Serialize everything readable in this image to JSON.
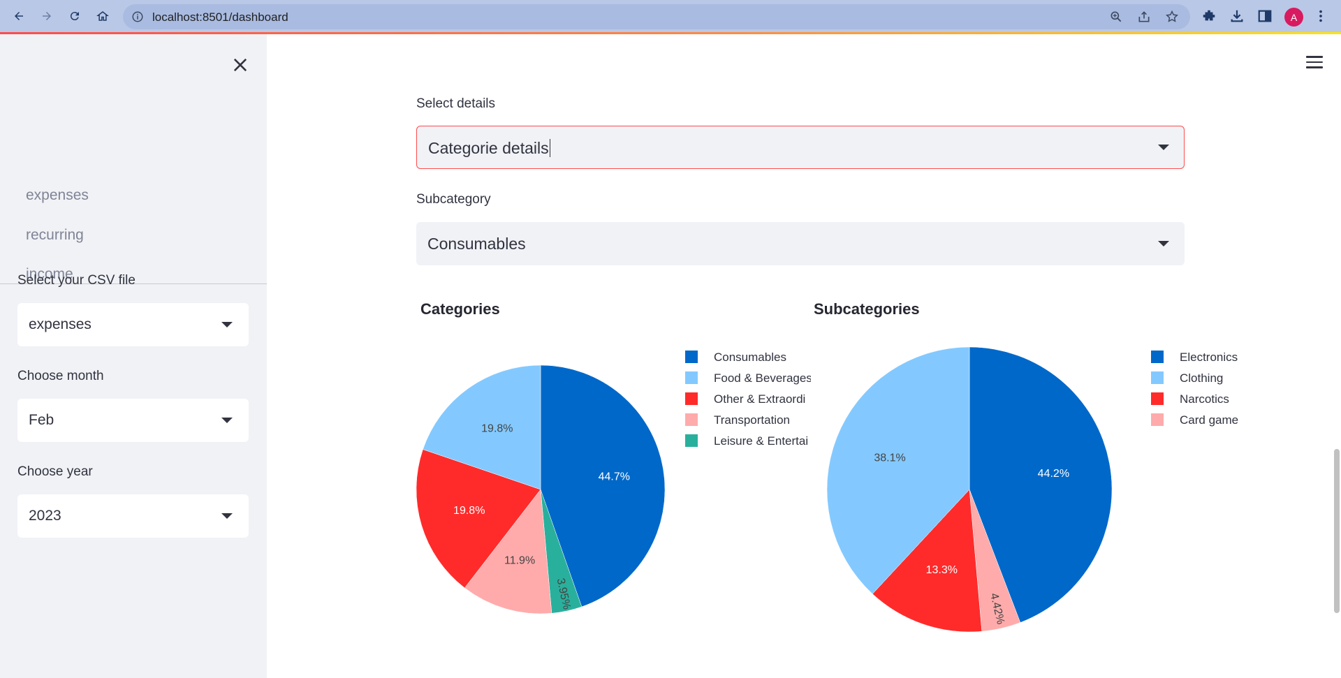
{
  "browser": {
    "url": "localhost:8501/dashboard",
    "profile_initial": "A"
  },
  "sidebar": {
    "pages": [
      "expenses",
      "recurring",
      "income"
    ],
    "csv": {
      "label": "Select your CSV file",
      "value": "expenses"
    },
    "month": {
      "label": "Choose month",
      "value": "Feb"
    },
    "year": {
      "label": "Choose year",
      "value": "2023"
    }
  },
  "main": {
    "details": {
      "label": "Select details",
      "value": "Categorie details"
    },
    "subcategory": {
      "label": "Subcategory",
      "value": "Consumables"
    }
  },
  "chart_data": [
    {
      "type": "pie",
      "title": "Categories",
      "labels": [
        "Consumables",
        "Food & Beverages",
        "Other & Extraordinary",
        "Transportation",
        "Leisure & Entertainment"
      ],
      "legend_labels": [
        "Consumables",
        "Food & Beverages",
        "Other & Extraordi",
        "Transportation",
        "Leisure & Entertai"
      ],
      "values": [
        44.7,
        19.8,
        19.8,
        11.9,
        3.95
      ],
      "value_labels": [
        "44.7%",
        "19.8%",
        "19.8%",
        "11.9%",
        "3.95%"
      ],
      "colors": [
        "#0068c9",
        "#83c9ff",
        "#ff2b2b",
        "#ffabab",
        "#29b09d"
      ],
      "slice_order": [
        0,
        4,
        3,
        2,
        1
      ],
      "direction": "clockwise",
      "legend_position": "right"
    },
    {
      "type": "pie",
      "title": "Subcategories",
      "labels": [
        "Electronics",
        "Clothing",
        "Narcotics",
        "Card game"
      ],
      "legend_labels": [
        "Electronics",
        "Clothing",
        "Narcotics",
        "Card game"
      ],
      "values": [
        44.2,
        38.1,
        13.3,
        4.42
      ],
      "value_labels": [
        "44.2%",
        "38.1%",
        "13.3%",
        "4.42%"
      ],
      "colors": [
        "#0068c9",
        "#83c9ff",
        "#ff2b2b",
        "#ffabab"
      ],
      "slice_order": [
        0,
        3,
        2,
        1
      ],
      "direction": "clockwise",
      "legend_position": "right"
    }
  ]
}
